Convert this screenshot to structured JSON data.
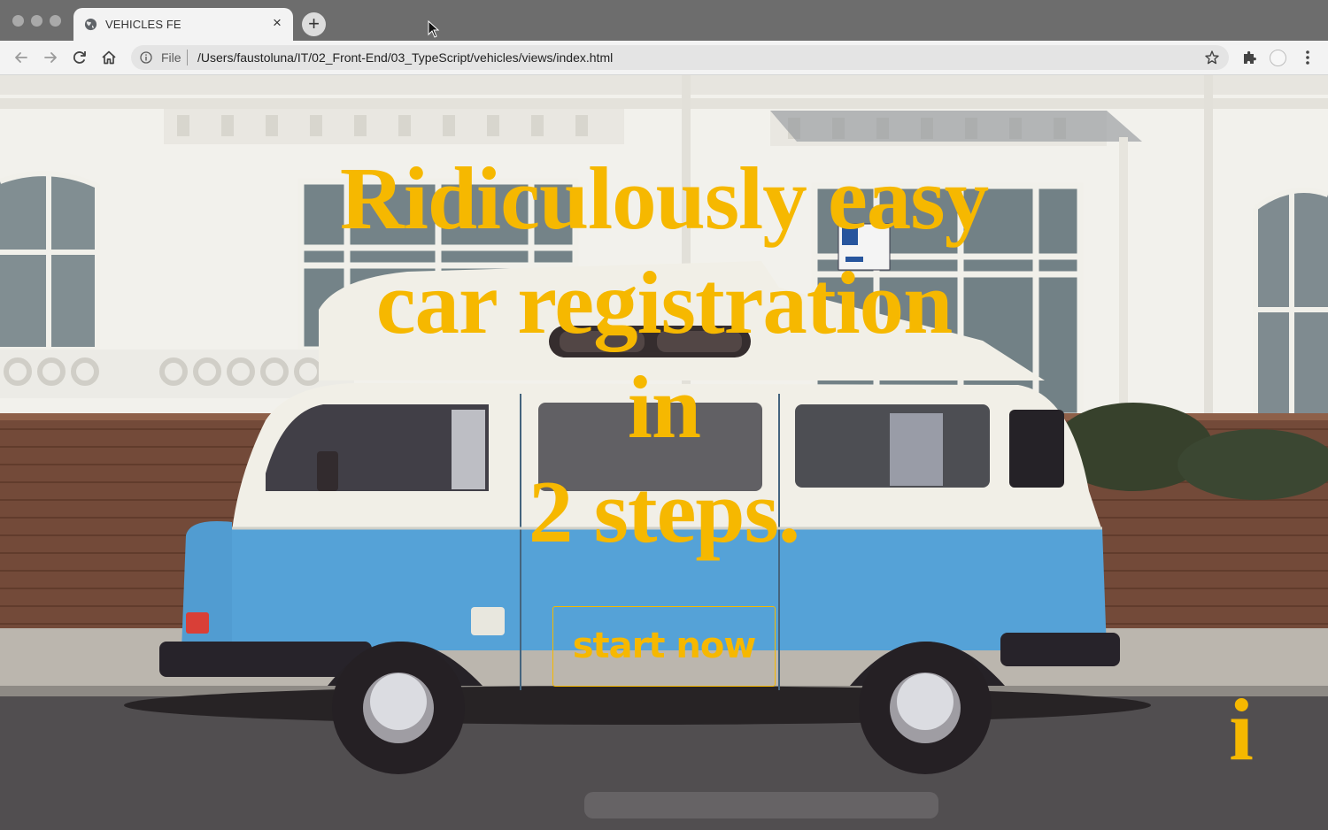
{
  "browser": {
    "tab_title": "VEHICLES FE",
    "tab_close": "×",
    "new_tab": "+",
    "scheme_label": "File",
    "url": "/Users/faustoluna/IT/02_Front-End/03_TypeScript/vehicles/views/index.html",
    "icons": [
      "globe-icon",
      "close-icon",
      "plus-icon",
      "back-arrow-icon",
      "forward-arrow-icon",
      "reload-icon",
      "home-icon",
      "info-icon",
      "star-icon",
      "puzzle-extension-icon",
      "avatar",
      "kebab-menu-icon",
      "mouse-pointer-icon"
    ]
  },
  "hero": {
    "title_lines": [
      "Ridiculously easy",
      "car registration",
      "in",
      "2 steps."
    ],
    "cta_label": "start now",
    "info_label": "i"
  },
  "background": {
    "description_free_colors": {
      "accent": "#f6b800",
      "van_blue": "#4f9fd6",
      "van_white": "#f1efe6",
      "brick": "#6e4331",
      "facade": "#f2f1ec",
      "road": "#4a4749"
    }
  }
}
